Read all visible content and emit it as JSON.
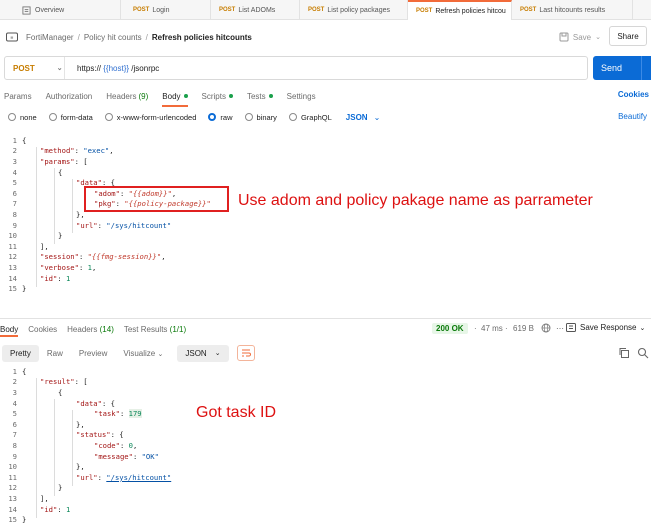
{
  "tabs": [
    {
      "method": "",
      "label": "Overview"
    },
    {
      "method": "POST",
      "label": "Login"
    },
    {
      "method": "POST",
      "label": "List ADOMs"
    },
    {
      "method": "POST",
      "label": "List policy packages"
    },
    {
      "method": "POST",
      "label": "Refresh policies hitcou"
    },
    {
      "method": "POST",
      "label": "Last hitcounts results"
    }
  ],
  "breadcrumb": {
    "root": "FortiManager",
    "folder": "Policy hit counts",
    "current": "Refresh policies hitcounts",
    "save_label": "Save",
    "share_label": "Share"
  },
  "request": {
    "method": "POST",
    "url_prefix": "https://",
    "url_var": "{{host}}",
    "url_suffix": "/jsonrpc",
    "send_label": "Send"
  },
  "request_tabs": {
    "params": "Params",
    "authorization": "Authorization",
    "headers": "Headers",
    "headers_count": "(9)",
    "body": "Body",
    "scripts": "Scripts",
    "tests": "Tests",
    "settings": "Settings",
    "cookies": "Cookies"
  },
  "body_types": {
    "none": "none",
    "form_data": "form-data",
    "urlencoded": "x-www-form-urlencoded",
    "raw": "raw",
    "binary": "binary",
    "graphql": "GraphQL",
    "format": "JSON",
    "beautify": "Beautify"
  },
  "request_body": {
    "line_numbers": [
      "1",
      "2",
      "3",
      "4",
      "5",
      "6",
      "7",
      "8",
      "9",
      "10",
      "11",
      "12",
      "13",
      "14",
      "15"
    ],
    "l1": "{",
    "l2_key": "\"method\"",
    "l2_val": "\"exec\"",
    "l3_key": "\"params\"",
    "l3_p": ": [",
    "l4": "{",
    "l5_key": "\"data\"",
    "l5_p": ": {",
    "l6_key": "\"adom\"",
    "l6_val": "\"{{adom}}\"",
    "l7_key": "\"pkg\"",
    "l7_val": "\"{{policy-package}}\"",
    "l8": "},",
    "l9_key": "\"url\"",
    "l9_val": "\"/sys/hitcount\"",
    "l10": "}",
    "l11": "],",
    "l12_key": "\"session\"",
    "l12_val": "\"{{fmg-session}}\"",
    "l13_key": "\"verbose\"",
    "l13_val": "1",
    "l14_key": "\"id\"",
    "l14_val": "1",
    "l15": "}"
  },
  "annotation_request": "Use adom and policy pakage name as parrameter",
  "response_tabs": {
    "body": "Body",
    "cookies": "Cookies",
    "headers": "Headers",
    "headers_count": "(14)",
    "test_results": "Test Results",
    "test_count": "(1/1)",
    "status": "200 OK",
    "time": "47 ms",
    "size": "619 B",
    "save_response": "Save Response"
  },
  "view_tabs": {
    "pretty": "Pretty",
    "raw": "Raw",
    "preview": "Preview",
    "visualize": "Visualize",
    "format": "JSON"
  },
  "response_body": {
    "line_numbers": [
      "1",
      "2",
      "3",
      "4",
      "5",
      "6",
      "7",
      "8",
      "9",
      "10",
      "11",
      "12",
      "13",
      "14",
      "15"
    ],
    "l1": "{",
    "l2_key": "\"result\"",
    "l2_p": ": [",
    "l3": "{",
    "l4_key": "\"data\"",
    "l4_p": ": {",
    "l5_key": "\"task\"",
    "l5_val": "179",
    "l6": "},",
    "l7_key": "\"status\"",
    "l7_p": ": {",
    "l8_key": "\"code\"",
    "l8_val": "0",
    "l9_key": "\"message\"",
    "l9_val": "\"OK\"",
    "l10": "},",
    "l11_key": "\"url\"",
    "l11_val": "\"/sys/hitcount\"",
    "l12": "}",
    "l13": "],",
    "l14_key": "\"id\"",
    "l14_val": "1",
    "l15": "}"
  },
  "annotation_response": "Got task ID",
  "colors": {
    "accent": "#f26b3a",
    "send": "#0b6bd6",
    "annotation": "#e02020",
    "status_ok": "#0b7a0b"
  }
}
